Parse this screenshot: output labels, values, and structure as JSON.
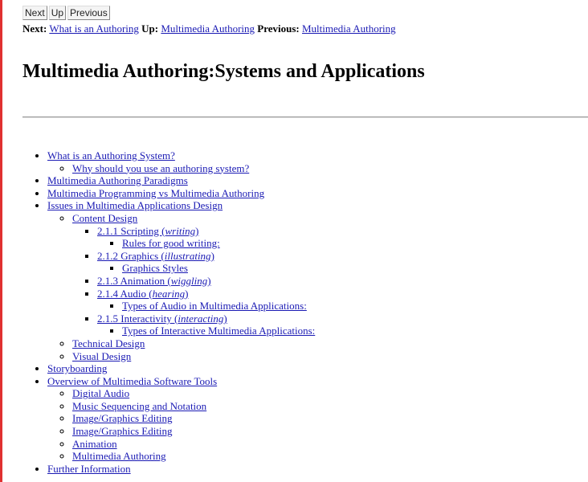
{
  "nav_buttons": {
    "next": "Next",
    "up": "Up",
    "previous": "Previous"
  },
  "nav_line": {
    "next_label": "Next:",
    "next_link": "What is an Authoring",
    "up_label": "Up:",
    "up_link": "Multimedia Authoring",
    "previous_label": "Previous:",
    "previous_link": "Multimedia Authoring"
  },
  "title": "Multimedia Authoring:Systems and Applications",
  "toc": [
    {
      "label": "What is an Authoring System?",
      "children": [
        {
          "label": "Why should you use an authoring system?"
        }
      ]
    },
    {
      "label": "Multimedia Authoring Paradigms"
    },
    {
      "label": "Multimedia Programming vs Multimedia Authoring"
    },
    {
      "label": "Issues in Multimedia Applications Design",
      "children": [
        {
          "label": "Content Design",
          "children": [
            {
              "label": "2.1.1 Scripting (",
              "em": "writing",
              "tail": ")",
              "children": [
                {
                  "label": "Rules for good writing:"
                }
              ]
            },
            {
              "label": "2.1.2 Graphics (",
              "em": "illustrating",
              "tail": ")",
              "children": [
                {
                  "label": "Graphics Styles"
                }
              ]
            },
            {
              "label": "2.1.3 Animation (",
              "em": "wiggling",
              "tail": ")"
            },
            {
              "label": "2.1.4 Audio (",
              "em": "hearing",
              "tail": ")",
              "children": [
                {
                  "label": "Types of Audio in Multimedia Applications:"
                }
              ]
            },
            {
              "label": "2.1.5 Interactivity (",
              "em": "interacting",
              "tail": ")",
              "children": [
                {
                  "label": "Types of Interactive Multimedia Applications:"
                }
              ]
            }
          ]
        },
        {
          "label": "Technical Design"
        },
        {
          "label": "Visual Design"
        }
      ]
    },
    {
      "label": "Storyboarding"
    },
    {
      "label": "Overview of Multimedia Software Tools",
      "children": [
        {
          "label": "Digital Audio"
        },
        {
          "label": "Music Sequencing and Notation"
        },
        {
          "label": "Image/Graphics Editing"
        },
        {
          "label": "Image/Graphics Editing"
        },
        {
          "label": "Animation"
        },
        {
          "label": "Multimedia Authoring"
        }
      ]
    },
    {
      "label": "Further Information"
    }
  ]
}
